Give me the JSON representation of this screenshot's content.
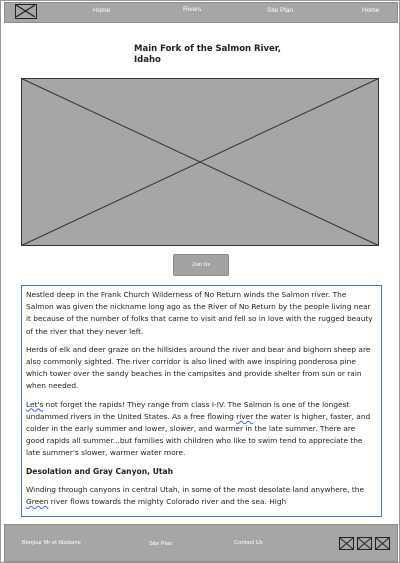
{
  "nav": {
    "items": [
      "Home",
      "Rivers",
      "Site Plan",
      "Home"
    ]
  },
  "page": {
    "title_line1": "Main Fork of the Salmon River,",
    "title_line2": "Idaho"
  },
  "join_button": "Join Us",
  "article": {
    "p1": "Nestled deep in the Frank Church Wilderness of No Return winds the Salmon river. The Salmon was given the nickname long ago as the River of No Return by the people living near it because of the number of folks that came to visit and fell so in love with the rugged beauty of the river that they never left.",
    "p2": "Herds of elk and deer graze on the hillsides around the river and bear and bighorn sheep are also commonly sighted. The river corridor is also lined with awe inspiring ponderosa pine which tower over the sandy beaches in the campsites and provide shelter from sun or rain when needed.",
    "p3_a": "Let's",
    "p3_b": " not forget the rapids! They range from class I-IV. The Salmon is one of the longest undammed rivers in the United States. As a free flowing ",
    "p3_c": "river",
    "p3_d": " the water is higher, faster, and colder in the early summer and lower, slower, and warmer in the late summer. There are good rapids all summer...but families with children who like to swim tend to appreciate the late summer's slower, warmer water more.",
    "heading": "Desolation and Gray Canyon, Utah",
    "p4_a": "Winding through canyons in central Utah, in some of the most desolate land anywhere, the ",
    "p4_b": "Green",
    "p4_c": " river flows towards the mighty Colorado river and the sea. High"
  },
  "footer": {
    "items": [
      "Bonjour Mr et Madame",
      "Site Plan",
      "Contact Us"
    ],
    "icons": [
      "social-icon-1",
      "social-icon-2",
      "social-icon-3"
    ]
  }
}
